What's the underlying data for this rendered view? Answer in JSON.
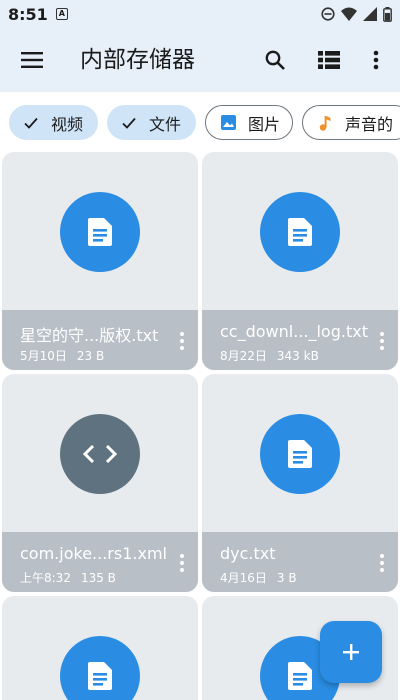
{
  "status_bar": {
    "time": "8:51",
    "notification_letter": "A"
  },
  "app_bar": {
    "title": "内部存储器"
  },
  "chips": [
    {
      "label": "视频",
      "selected": true,
      "icon": "check-icon"
    },
    {
      "label": "文件",
      "selected": true,
      "icon": "check-icon"
    },
    {
      "label": "图片",
      "selected": false,
      "icon": "image-icon"
    },
    {
      "label": "声音的",
      "selected": false,
      "icon": "music-note-icon"
    }
  ],
  "files": [
    {
      "name": "星空的守...版权.txt",
      "date": "5月10日",
      "size": "23 B",
      "icon": "document-icon",
      "icon_color": "#2a8de3"
    },
    {
      "name": "cc_downl..._log.txt",
      "date": "8月22日",
      "size": "343 kB",
      "icon": "document-icon",
      "icon_color": "#2a8de3"
    },
    {
      "name": "com.joke...rs1.xml",
      "date": "上午8:32",
      "size": "135 B",
      "icon": "code-icon",
      "icon_color": "#5f7280"
    },
    {
      "name": "dyc.txt",
      "date": "4月16日",
      "size": "3 B",
      "icon": "document-icon",
      "icon_color": "#2a8de3"
    },
    {
      "name": "",
      "date": "",
      "size": "",
      "icon": "document-icon",
      "icon_color": "#2a8de3"
    },
    {
      "name": "",
      "date": "",
      "size": "",
      "icon": "document-icon",
      "icon_color": "#2a8de3"
    }
  ],
  "colors": {
    "accent": "#2a8de3",
    "app_bar_bg": "#e7f0f8",
    "chip_selected_bg": "#cfe5f7",
    "card_bg": "#e8ebee",
    "card_info_bg": "#b9bfc6"
  }
}
